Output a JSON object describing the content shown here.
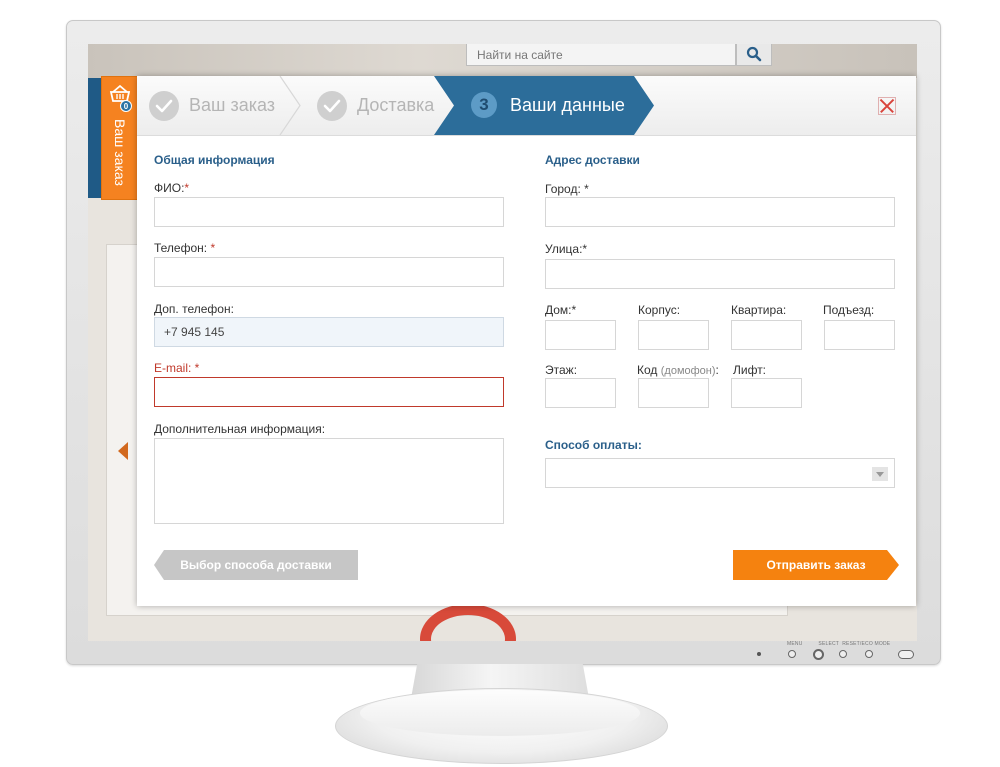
{
  "background": {
    "search_placeholder": "Найти на сайте"
  },
  "cart_tab": {
    "label": "Ваш заказ",
    "count": "0",
    "icon": "basket-icon",
    "color": "#f58220"
  },
  "steps": [
    {
      "label": "Ваш заказ",
      "state": "done",
      "icon": "check-icon"
    },
    {
      "label": "Доставка",
      "state": "done",
      "icon": "check-icon"
    },
    {
      "number": "3",
      "label": "Ваши данные",
      "state": "active"
    }
  ],
  "general": {
    "title": "Общая информация",
    "fio_label": "ФИО:",
    "fio_req": "*",
    "fio_value": "",
    "phone_label": "Телефон: ",
    "phone_req": "*",
    "phone_value": "",
    "extra_phone_label": "Доп. телефон:",
    "extra_phone_value": "+7 945 145",
    "email_label": "E-mail: ",
    "email_req": "*",
    "email_value": "",
    "info_label": "Дополнительная информация:",
    "info_value": ""
  },
  "address": {
    "title": "Адрес доставки",
    "city_label": "Город: ",
    "city_req": "*",
    "street_label": "Улица:",
    "street_req": "*",
    "house_label": "Дом:",
    "house_req": "*",
    "building_label": "Корпус:",
    "apartment_label": "Квартира:",
    "entrance_label": "Подъезд:",
    "floor_label": "Этаж:",
    "code_label": "Код ",
    "code_hint": "(домофон)",
    "code_colon": ":",
    "lift_label": "Лифт:"
  },
  "payment": {
    "title": "Способ оплаты:",
    "selected": ""
  },
  "buttons": {
    "back": "Выбор способа доставки",
    "submit": "Отправить заказ"
  },
  "colors": {
    "accent_blue": "#2c6d9a",
    "accent_orange": "#f5820f",
    "error_red": "#c0392b"
  }
}
